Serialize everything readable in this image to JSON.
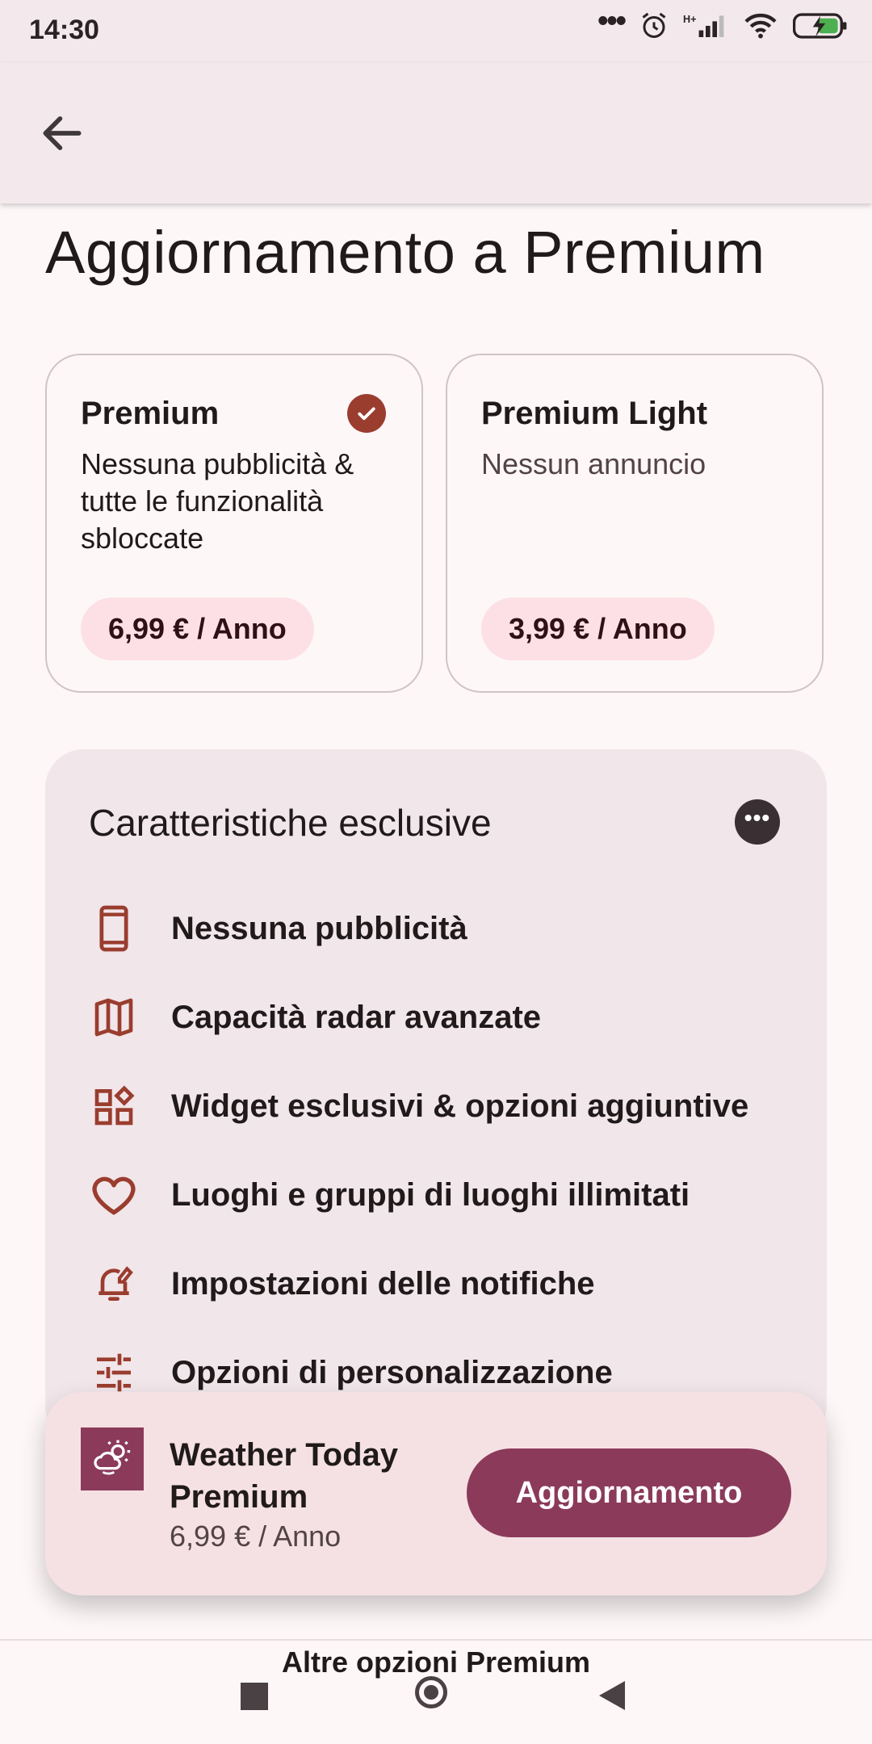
{
  "status_bar": {
    "time": "14:30",
    "network": "H+",
    "icons": [
      "dots-icon",
      "alarm-icon",
      "signal-icon",
      "wifi-icon",
      "battery-icon"
    ]
  },
  "app_bar": {
    "back_icon": "arrow-left-icon"
  },
  "page_title": "Aggiornamento a Premium",
  "plans": [
    {
      "name": "Premium",
      "description": "Nessuna pubblicità & tutte le funzionalità sbloccate",
      "price": "6,99 € / Anno",
      "selected": true
    },
    {
      "name": "Premium Light",
      "description": "Nessun annuncio",
      "price": "3,99 € / Anno",
      "selected": false
    }
  ],
  "features": {
    "title": "Caratteristiche esclusive",
    "more_icon": "more-horizontal-icon",
    "items": [
      {
        "label": "Nessuna pubblicità",
        "icon": "phone-icon"
      },
      {
        "label": "Capacità radar avanzate",
        "icon": "map-icon"
      },
      {
        "label": "Widget esclusivi & opzioni aggiuntive",
        "icon": "widgets-icon"
      },
      {
        "label": "Luoghi e gruppi di luoghi illimitati",
        "icon": "heart-icon"
      },
      {
        "label": "Impostazioni delle notifiche",
        "icon": "notification-settings-icon"
      },
      {
        "label": "Opzioni di personalizzazione",
        "icon": "sliders-icon"
      }
    ]
  },
  "upgrade_bar": {
    "app_name": "Weather Today Premium",
    "price": "6,99 € / Anno",
    "button_label": "Aggiornamento",
    "logo_icon": "weather-app-icon"
  },
  "more_options_label": "Altre opzioni Premium",
  "colors": {
    "accent": "#8b3a5a",
    "icon_accent": "#9a3d2f",
    "chip_bg": "#fde0e5",
    "card_bg": "#f1e6ea"
  }
}
